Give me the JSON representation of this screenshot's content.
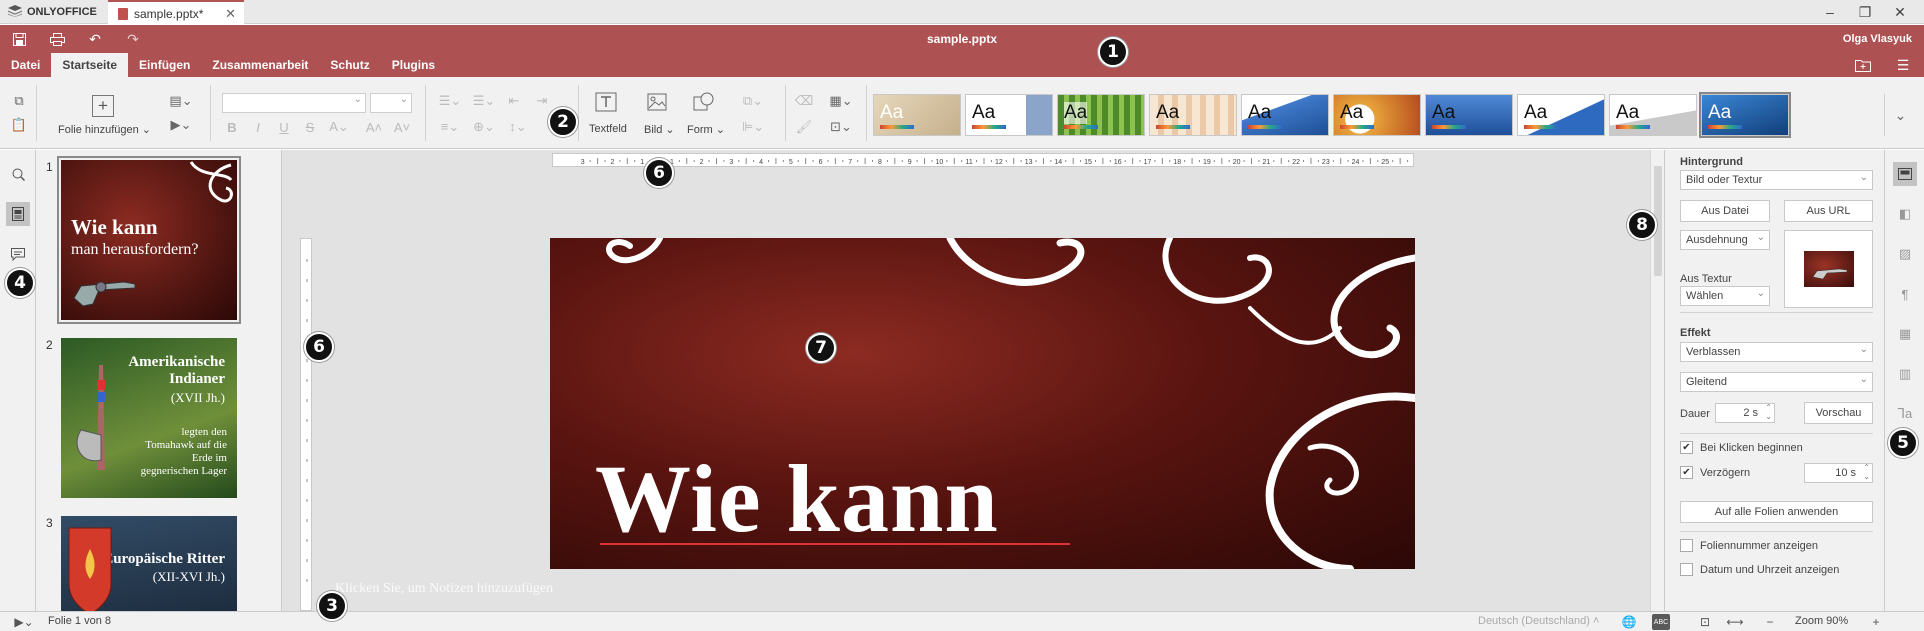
{
  "app": {
    "name": "ONLYOFFICE",
    "tab_title": "sample.pptx*",
    "doc_title": "sample.pptx",
    "user": "Olga Vlasyuk"
  },
  "menu": {
    "tabs": [
      "Datei",
      "Startseite",
      "Einfügen",
      "Zusammenarbeit",
      "Schutz",
      "Plugins"
    ],
    "active": "Startseite"
  },
  "toolbar": {
    "add_slide": "Folie hinzufügen",
    "textbox": "Textfeld",
    "image": "Bild",
    "shape": "Form"
  },
  "themes": [
    {
      "bg": "#d8c7a9",
      "fg": "#ffffff"
    },
    {
      "bg": "#ffffff",
      "fg": "#111111"
    },
    {
      "bg": "#6ba43a",
      "fg": "#111111"
    },
    {
      "bg": "#f3e2cf",
      "fg": "#111111"
    },
    {
      "bg": "#3f79c9",
      "fg": "#111111"
    },
    {
      "bg": "#e4a03a",
      "fg": "#111111"
    },
    {
      "bg": "#2e6bc0",
      "fg": "#111111"
    },
    {
      "bg": "#ffffff",
      "fg": "#111111"
    },
    {
      "bg": "#f4f4f4",
      "fg": "#111111"
    },
    {
      "bg": "#1d5fa8",
      "fg": "#ffffff"
    }
  ],
  "theme_label": "Aa",
  "slides": [
    {
      "number": "1",
      "title": "Wie kann",
      "subtitle": "man herausfordern?"
    },
    {
      "number": "2",
      "title": "Amerikanische Indianer",
      "subtitle": "(XVII Jh.)",
      "body": "legten den Tomahawk auf die Erde im gegnerischen Lager"
    },
    {
      "number": "3",
      "title": "Europäische Ritter",
      "subtitle": "(XII-XVI Jh.)"
    }
  ],
  "editor": {
    "slide_title": "Wie kann",
    "notes_placeholder": "Klicken Sie, um Notizen hinzuzufügen",
    "ruler_labels": [
      "3",
      "2",
      "1",
      "1",
      "2",
      "3",
      "4",
      "5",
      "6",
      "7",
      "8",
      "9",
      "10",
      "11",
      "12",
      "13",
      "14",
      "15",
      "16",
      "17",
      "18",
      "19",
      "20",
      "21",
      "22",
      "23",
      "24",
      "25"
    ]
  },
  "settings": {
    "background_label": "Hintergrund",
    "fill_type": "Bild oder Textur",
    "from_file": "Aus Datei",
    "from_url": "Aus URL",
    "stretch": "Ausdehnung",
    "from_texture": "Aus Textur",
    "choose": "Wählen",
    "effect_label": "Effekt",
    "effect": "Verblassen",
    "effect_type": "Gleitend",
    "duration_label": "Dauer",
    "duration": "2 s",
    "preview": "Vorschau",
    "on_click": "Bei Klicken beginnen",
    "delay": "Verzögern",
    "delay_value": "10 s",
    "apply_all": "Auf alle Folien anwenden",
    "show_slide_number": "Foliennummer anzeigen",
    "show_date_time": "Datum und Uhrzeit anzeigen"
  },
  "status": {
    "slide_info": "Folie 1 von 8",
    "language": "Deutsch (Deutschland)",
    "zoom": "Zoom 90%"
  },
  "callouts": [
    "1",
    "2",
    "3",
    "4",
    "5",
    "6",
    "6",
    "7",
    "8"
  ]
}
